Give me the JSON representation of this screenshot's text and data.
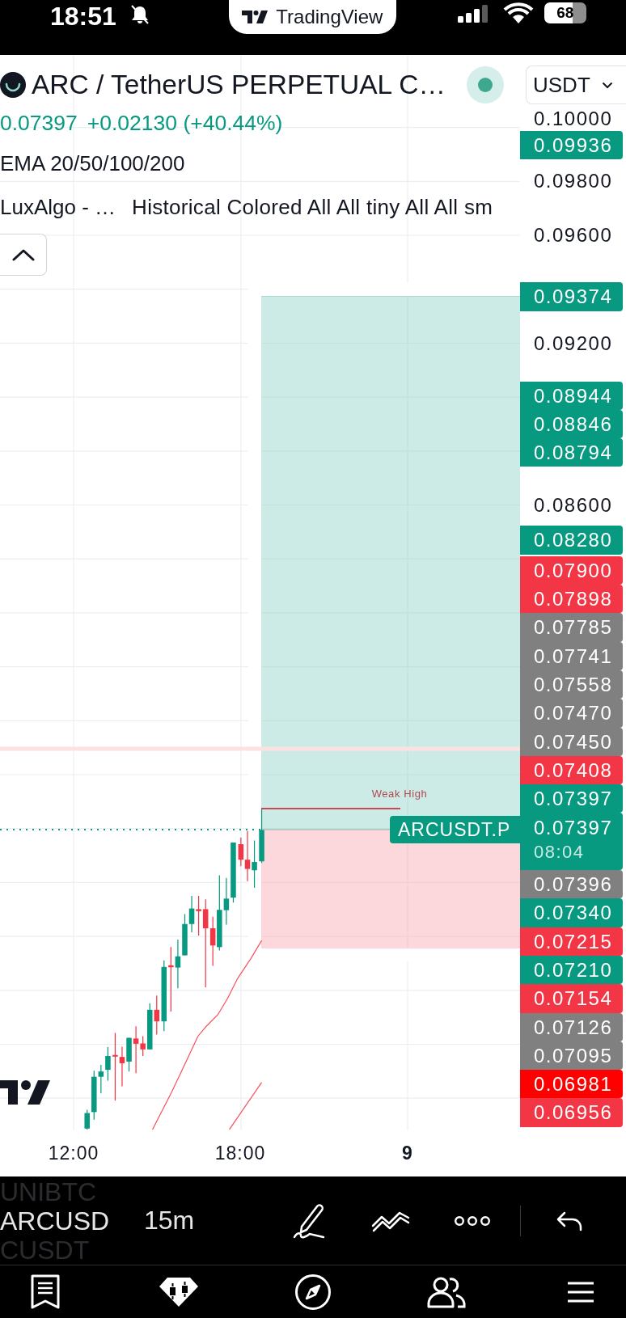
{
  "status_bar": {
    "time": "18:51",
    "app": "TradingView",
    "battery": "68"
  },
  "legend": {
    "title": "ARC / TetherUS PERPETUAL C…",
    "last_price": "0.07397",
    "change": "+0.02130 (+40.44%)",
    "indicators": [
      {
        "name": "EMA 20/50/100/200"
      },
      {
        "name": "LuxAlgo - …",
        "settings": "Historical Colored All All tiny All All sm"
      }
    ]
  },
  "currency": "USDT",
  "chart": {
    "annotation": "Weak High",
    "symbol_label": "ARCUSDT.P"
  },
  "price_axis": [
    {
      "kind": "tick",
      "text": "0.10000"
    },
    {
      "kind": "badge",
      "text": "0.09936",
      "color": "#089981"
    },
    {
      "kind": "tick",
      "text": "0.09800"
    },
    {
      "kind": "tick",
      "text": "0.09600"
    },
    {
      "kind": "badge",
      "text": "0.09374",
      "color": "#089981"
    },
    {
      "kind": "tick",
      "text": "0.09200"
    },
    {
      "kind": "badge",
      "text": "0.08944",
      "color": "#089981"
    },
    {
      "kind": "badge",
      "text": "0.08846",
      "color": "#089981"
    },
    {
      "kind": "badge",
      "text": "0.08794",
      "color": "#089981"
    },
    {
      "kind": "tick",
      "text": "0.08600"
    },
    {
      "kind": "badge",
      "text": "0.08280",
      "color": "#089981"
    },
    {
      "kind": "badge",
      "text": "0.07900",
      "color": "#f23645"
    },
    {
      "kind": "badge",
      "text": "0.07898",
      "color": "#f23645"
    },
    {
      "kind": "badge",
      "text": "0.07785",
      "color": "#808080"
    },
    {
      "kind": "badge",
      "text": "0.07741",
      "color": "#808080"
    },
    {
      "kind": "badge",
      "text": "0.07558",
      "color": "#808080"
    },
    {
      "kind": "badge",
      "text": "0.07470",
      "color": "#808080"
    },
    {
      "kind": "badge",
      "text": "0.07450",
      "color": "#808080"
    },
    {
      "kind": "badge",
      "text": "0.07408",
      "color": "#f23645"
    },
    {
      "kind": "badge",
      "text": "0.07397",
      "color": "#089981"
    },
    {
      "kind": "badge",
      "text": "0.07397",
      "countdown": "08:04",
      "color": "#089981"
    },
    {
      "kind": "badge",
      "text": "0.07396",
      "color": "#808080"
    },
    {
      "kind": "badge",
      "text": "0.07340",
      "color": "#089981"
    },
    {
      "kind": "badge",
      "text": "0.07215",
      "color": "#f23645"
    },
    {
      "kind": "badge",
      "text": "0.07210",
      "color": "#089981"
    },
    {
      "kind": "badge",
      "text": "0.07154",
      "color": "#f23645"
    },
    {
      "kind": "badge",
      "text": "0.07126",
      "color": "#808080"
    },
    {
      "kind": "badge",
      "text": "0.07095",
      "color": "#808080"
    },
    {
      "kind": "badge",
      "text": "0.06981",
      "color": "#ff0000"
    },
    {
      "kind": "badge",
      "text": "0.06956",
      "color": "#f23645"
    }
  ],
  "time_axis": [
    {
      "text": "12:00",
      "kind": "time"
    },
    {
      "text": "18:00",
      "kind": "time"
    },
    {
      "text": "9",
      "kind": "day"
    }
  ],
  "toolbar": {
    "symbols": [
      {
        "text": "UNIBTC",
        "selected": false
      },
      {
        "text": "ARCUSD",
        "selected": true
      },
      {
        "text": "CUSDT",
        "selected": false
      }
    ],
    "interval": "15m"
  }
}
